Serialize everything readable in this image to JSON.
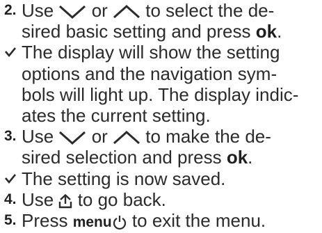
{
  "steps": [
    {
      "marker": "2.",
      "t1": "Use ",
      "t2": " or ",
      "t3": " to select the de-",
      "t4": "sired basic setting and press ",
      "ok": "ok",
      "t5": "."
    },
    {
      "t1": "The display will show the setting",
      "t2": "options and the navigation sym-",
      "t3": "bols will light up. The display indic-",
      "t4": "ates the current setting."
    },
    {
      "marker": "3.",
      "t1": "Use ",
      "t2": " or ",
      "t3": " to make the de-",
      "t4": "sired selection and press ",
      "ok": "ok",
      "t5": "."
    },
    {
      "t1": "The setting is now saved."
    },
    {
      "marker": "4.",
      "t1": "Use ",
      "t2": " to go back."
    },
    {
      "marker": "5.",
      "t1": "Press ",
      "menu": "menu",
      "t2": " to exit the menu."
    }
  ],
  "icons": {
    "down": "chevron-down-icon",
    "up": "chevron-up-icon",
    "back": "back-icon",
    "power": "power-icon",
    "check": "check-icon"
  }
}
